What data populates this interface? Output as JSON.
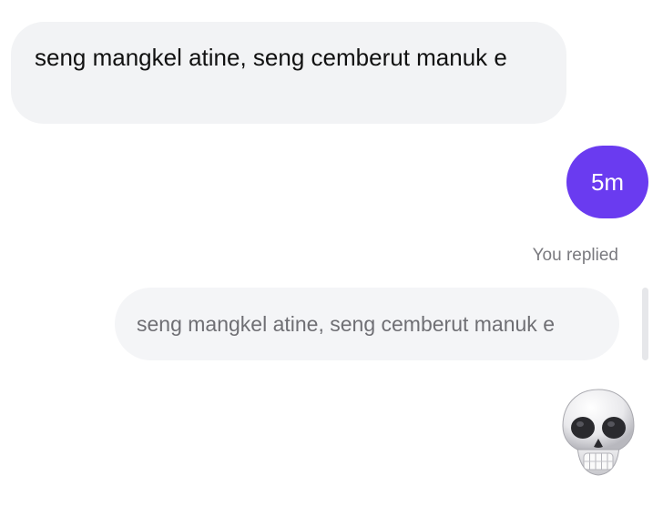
{
  "messages": {
    "incoming_text": "seng mangkel atine, seng cemberut manuk e",
    "outgoing_text": "5m",
    "reply_label": "You replied",
    "quoted_text": "seng mangkel atine, seng cemberut manuk e",
    "reaction_icon": "skull-emoji"
  },
  "colors": {
    "outgoing_bubble": "#6a3bf0",
    "incoming_bubble": "#f2f3f5",
    "muted_text": "#7a7a7f"
  }
}
